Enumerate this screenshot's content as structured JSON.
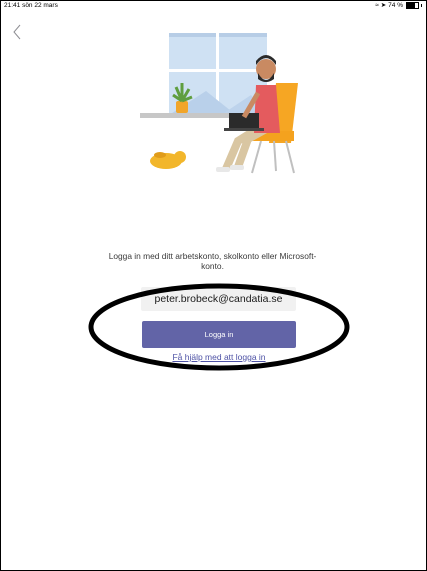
{
  "status_bar": {
    "time_date": "21:41  sön 22 mars",
    "battery_label": "74 %",
    "battery_level": 0.74
  },
  "nav": {
    "back_icon": "chevron-left-icon"
  },
  "illustration": {
    "name": "person-with-laptop-illustration"
  },
  "login": {
    "prompt": "Logga in med ditt arbetskonto, skolkonto eller Microsoft-konto.",
    "email_value": "peter.brobeck@candatia.se",
    "button_label": "Logga in",
    "help_link": "Få hjälp med att logga in"
  },
  "colors": {
    "accent": "#6264a7",
    "link": "#4e52a5",
    "field_bg": "#f1f1f1",
    "annotation": "#000000"
  }
}
